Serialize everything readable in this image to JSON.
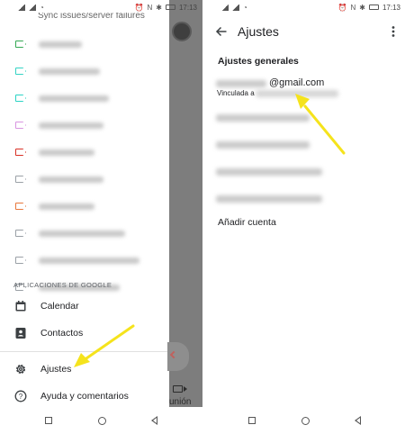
{
  "left_screen": {
    "status_bar": {
      "time": "17:13"
    },
    "sync_row_label": "Sync issues/server failures",
    "label_icons": [
      {
        "color": "#34a853"
      },
      {
        "color": "#34d3c4"
      },
      {
        "color": "#2bd3c4"
      },
      {
        "color": "#d894e0"
      },
      {
        "color": "#d93025"
      },
      {
        "color": "#9aa0a6"
      },
      {
        "color": "#e8773b"
      },
      {
        "color": "#9aa0a6"
      },
      {
        "color": "#9aa0a6"
      },
      {
        "color": "#9aa0a6"
      }
    ],
    "google_apps_header": "APLICACIONES DE GOOGLE",
    "apps": [
      {
        "label": "Calendar",
        "icon": "calendar-icon"
      },
      {
        "label": "Contactos",
        "icon": "contacts-icon"
      },
      {
        "label": "Ajustes",
        "icon": "gear-icon"
      },
      {
        "label": "Ayuda y comentarios",
        "icon": "help-icon"
      }
    ],
    "behind_drawer": {
      "meet_label": "unión"
    }
  },
  "right_screen": {
    "status_bar": {
      "time": "17:13"
    },
    "title": "Ajustes",
    "section_header": "Ajustes generales",
    "primary_account": {
      "email_suffix": "@gmail.com",
      "linked_prefix": "Vinculada a"
    },
    "add_account_label": "Añadir cuenta"
  },
  "colors": {
    "annotation_arrow": "#f5e31c",
    "scrim": "#7d7d7d"
  }
}
